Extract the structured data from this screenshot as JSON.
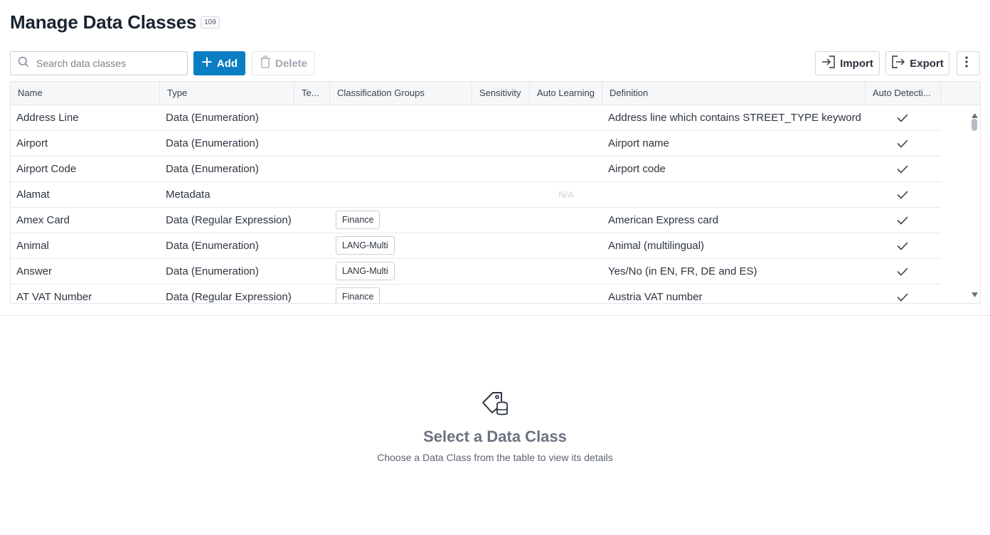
{
  "header": {
    "title": "Manage Data Classes",
    "count": "109"
  },
  "toolbar": {
    "search_placeholder": "Search data classes",
    "add_label": "Add",
    "delete_label": "Delete",
    "import_label": "Import",
    "export_label": "Export"
  },
  "table": {
    "columns": [
      "Name",
      "Type",
      "Te...",
      "Classification Groups",
      "Sensitivity",
      "Auto Learning",
      "Definition",
      "Auto Detecti..."
    ],
    "rows": [
      {
        "name": "Address Line",
        "type": "Data (Enumeration)",
        "group": "",
        "auto_learning": "",
        "definition": "Address line which contains STREET_TYPE keyword",
        "auto_detection": true
      },
      {
        "name": "Airport",
        "type": "Data (Enumeration)",
        "group": "",
        "auto_learning": "",
        "definition": "Airport name",
        "auto_detection": true
      },
      {
        "name": "Airport Code",
        "type": "Data (Enumeration)",
        "group": "",
        "auto_learning": "",
        "definition": "Airport code",
        "auto_detection": true
      },
      {
        "name": "Alamat",
        "type": "Metadata",
        "group": "",
        "auto_learning": "N/A",
        "definition": "",
        "auto_detection": true
      },
      {
        "name": "Amex Card",
        "type": "Data (Regular Expression)",
        "group": "Finance",
        "auto_learning": "",
        "definition": "American Express card",
        "auto_detection": true
      },
      {
        "name": "Animal",
        "type": "Data (Enumeration)",
        "group": "LANG-Multi",
        "auto_learning": "",
        "definition": "Animal (multilingual)",
        "auto_detection": true
      },
      {
        "name": "Answer",
        "type": "Data (Enumeration)",
        "group": "LANG-Multi",
        "auto_learning": "",
        "definition": "Yes/No (in EN, FR, DE and ES)",
        "auto_detection": true
      },
      {
        "name": "AT VAT Number",
        "type": "Data (Regular Expression)",
        "group": "Finance",
        "auto_learning": "",
        "definition": "Austria VAT number",
        "auto_detection": true
      }
    ]
  },
  "empty_state": {
    "title": "Select a Data Class",
    "subtitle": "Choose a Data Class from the table to view its details"
  },
  "colors": {
    "primary": "#0a7ec2",
    "title": "#1b2430",
    "muted": "#6b7280"
  }
}
